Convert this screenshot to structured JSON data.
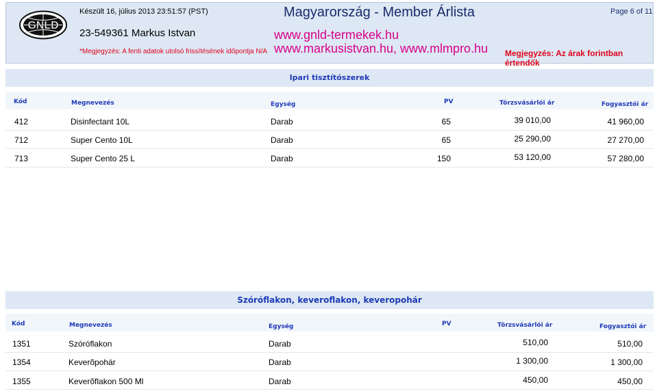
{
  "header": {
    "generated": "Készült 16, július 2013 23:51:57 (PST)",
    "member": "23-549361  Markus Istvan",
    "note_left": "*Megjegyzés: A fenti adatok utolsó frissítésének időpontja N/A",
    "title": "Magyarország - Member Árlista",
    "url1": "www.gnld-termekek.hu",
    "url2": "www.markusistvan.hu, www.mlmpro.hu",
    "page": "Page 6 of 11",
    "note_right": "Megjegyzés: Az árak forintban értendők",
    "logo_text": "GNLD"
  },
  "columns": {
    "kod": "Kód",
    "megnevezes": "Megnevezés",
    "egyseg": "Egység",
    "pv": "PV",
    "torzs": "Törzsvásárlói ár",
    "fogy": "Fogyasztói ár"
  },
  "sections": [
    {
      "title": "Ipari tisztítószerek",
      "rows": [
        {
          "kod": "412",
          "name": "Disinfectant 10L",
          "unit": "Darab",
          "pv": "65",
          "torzs": "39 010,00",
          "fogy": "41 960,00"
        },
        {
          "kod": "712",
          "name": "Super Cento 10L",
          "unit": "Darab",
          "pv": "65",
          "torzs": "25 290,00",
          "fogy": "27 270,00"
        },
        {
          "kod": "713",
          "name": "Super Cento 25 L",
          "unit": "Darab",
          "pv": "150",
          "torzs": "53 120,00",
          "fogy": "57 280,00"
        }
      ]
    },
    {
      "title": "Szóróflakon, keveroflakon, keveropohár",
      "rows": [
        {
          "kod": "1351",
          "name": "Szóróflakon",
          "unit": "Darab",
          "pv": "",
          "torzs": "510,00",
          "fogy": "510,00"
        },
        {
          "kod": "1354",
          "name": "Keverõpohár",
          "unit": "Darab",
          "pv": "",
          "torzs": "1 300,00",
          "fogy": "1 300,00"
        },
        {
          "kod": "1355",
          "name": "Keverõflakon 500 Ml",
          "unit": "Darab",
          "pv": "",
          "torzs": "450,00",
          "fogy": "450,00"
        }
      ]
    }
  ]
}
